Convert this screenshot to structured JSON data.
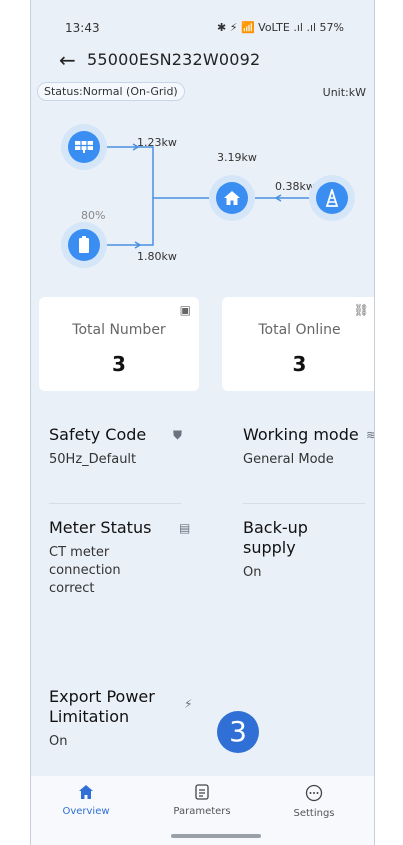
{
  "status_bar": {
    "time": "13:43",
    "indicators": "✱ ⚡ 📶 VoLTE .ıl .ıl 57%"
  },
  "header": {
    "title": "55000ESN232W0092"
  },
  "overview": {
    "status": "Status:Normal (On-Grid)",
    "unit": "Unit:kW"
  },
  "flow": {
    "pv_power": "1.23kw",
    "home_power": "3.19kw",
    "grid_power": "0.38kw",
    "battery_soc": "80%",
    "battery_power": "1.80kw"
  },
  "cards": [
    {
      "label": "Total Number",
      "value": "3"
    },
    {
      "label": "Total Online",
      "value": "3"
    }
  ],
  "info": {
    "safety_code": {
      "label": "Safety Code",
      "value": "50Hz_Default"
    },
    "working_mode": {
      "label": "Working mode",
      "value": "General Mode"
    },
    "meter_status": {
      "label": "Meter Status",
      "value": "CT meter connection correct"
    },
    "backup_supply": {
      "label": "Back-up supply",
      "value": "On"
    },
    "export_limit": {
      "label": "Export Power Limitation",
      "value": "On"
    }
  },
  "step_badge": "3",
  "tabs": [
    {
      "label": "Overview"
    },
    {
      "label": "Parameters"
    },
    {
      "label": "Settings"
    }
  ],
  "colors": {
    "accent": "#2f6fd6",
    "background": "#eaf0f8"
  }
}
